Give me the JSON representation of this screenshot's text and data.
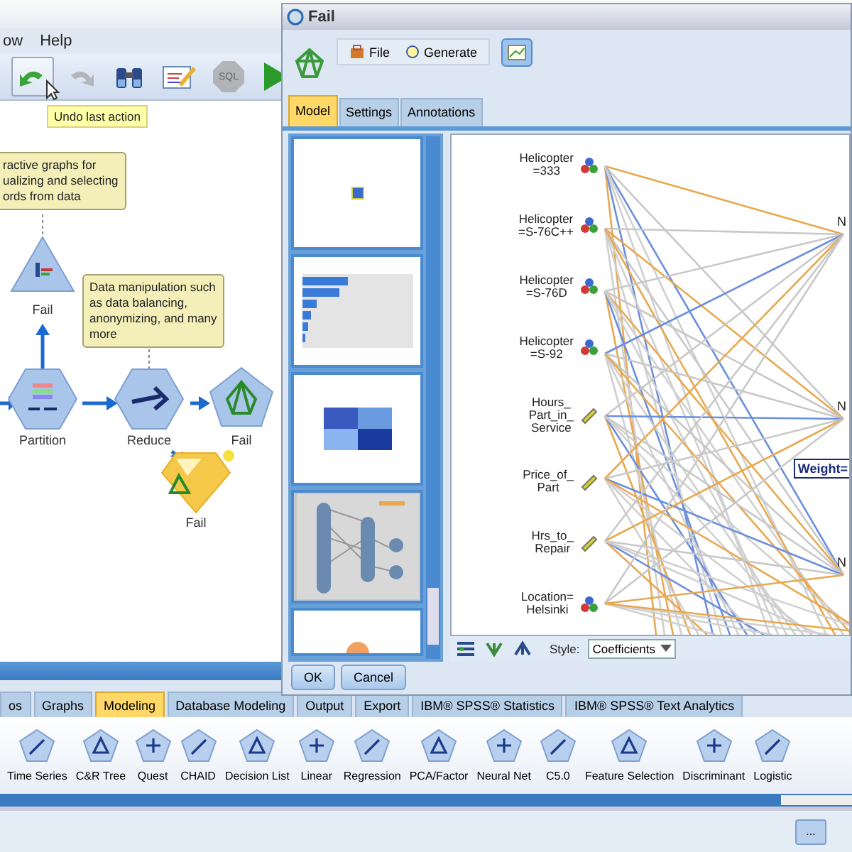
{
  "main_window": {
    "menu": [
      "ow",
      "Help"
    ],
    "toolbar": [
      {
        "kind": "undo",
        "selected": true,
        "disabled": false
      },
      {
        "kind": "redo",
        "selected": false,
        "disabled": true
      },
      {
        "kind": "find",
        "selected": false,
        "disabled": false
      },
      {
        "kind": "edit",
        "selected": false,
        "disabled": false
      },
      {
        "kind": "sql",
        "label": "SQL",
        "selected": false,
        "disabled": true
      },
      {
        "kind": "run",
        "selected": false,
        "disabled": false
      }
    ],
    "tooltip": "Undo last action",
    "comments": [
      {
        "text": "ractive graphs for\nualizing and selecting\nords from data"
      },
      {
        "text": "Data manipulation such\nas data balancing,\nanonymizing, and many\nmore"
      }
    ],
    "nodes": [
      {
        "kind": "graph",
        "label": "Fail"
      },
      {
        "kind": "partition",
        "label": "Partition"
      },
      {
        "kind": "reduce",
        "label": "Reduce"
      },
      {
        "kind": "neural",
        "label": "Fail"
      },
      {
        "kind": "nugget",
        "label": "Fail"
      }
    ],
    "palette_tabs": [
      {
        "label": "os",
        "selected": false
      },
      {
        "label": "Graphs",
        "selected": false
      },
      {
        "label": "Modeling",
        "selected": true
      },
      {
        "label": "Database Modeling",
        "selected": false
      },
      {
        "label": "Output",
        "selected": false
      },
      {
        "label": "Export",
        "selected": false
      },
      {
        "label": "IBM® SPSS® Statistics",
        "selected": false
      },
      {
        "label": "IBM® SPSS® Text Analytics",
        "selected": false
      }
    ],
    "palette": [
      "Time Series",
      "C&R Tree",
      "Quest",
      "CHAID",
      "Decision List",
      "Linear",
      "Regression",
      "PCA/Factor",
      "Neural Net",
      "C5.0",
      "Feature Selection",
      "Discriminant",
      "Logistic"
    ],
    "status_button": "..."
  },
  "dialog": {
    "title": "Fail",
    "menu": [
      "File",
      "Generate"
    ],
    "tabs": [
      {
        "label": "Model",
        "selected": true
      },
      {
        "label": "Settings",
        "selected": false
      },
      {
        "label": "Annotations",
        "selected": false
      }
    ],
    "thumbnails": [
      {
        "kind": "icon",
        "selected": false
      },
      {
        "kind": "bars",
        "selected": false
      },
      {
        "kind": "heatmap",
        "selected": false
      },
      {
        "kind": "network",
        "selected": true
      },
      {
        "kind": "pie",
        "selected": false
      }
    ],
    "inputs": [
      {
        "label": "Helicopter\n=333",
        "kind": "set"
      },
      {
        "label": "Helicopter\n=S-76C++",
        "kind": "set"
      },
      {
        "label": "Helicopter\n=S-76D",
        "kind": "set"
      },
      {
        "label": "Helicopter\n=S-92",
        "kind": "set"
      },
      {
        "label": "Hours_\nPart_in_\nService",
        "kind": "range"
      },
      {
        "label": "Price_of_\nPart",
        "kind": "range"
      },
      {
        "label": "Hrs_to_\nRepair",
        "kind": "range"
      },
      {
        "label": "Location=\nHelsinki",
        "kind": "set"
      }
    ],
    "node_labels": [
      "N",
      "N",
      "N"
    ],
    "weight_tooltip": "Weight=",
    "style_label": "Style:",
    "style_value": "Coefficients",
    "buttons": [
      "OK",
      "Cancel"
    ]
  }
}
